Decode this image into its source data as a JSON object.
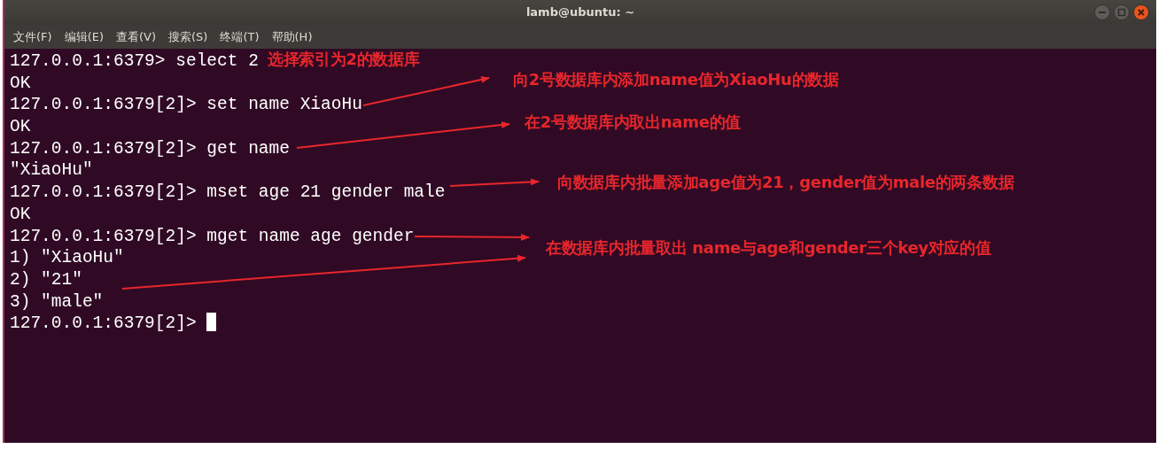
{
  "window": {
    "title": "lamb@ubuntu: ~"
  },
  "menu": [
    "文件(F)",
    "编辑(E)",
    "查看(V)",
    "搜索(S)",
    "终端(T)",
    "帮助(H)"
  ],
  "terminal": {
    "lines": [
      "127.0.0.1:6379> select 2",
      "OK",
      "127.0.0.1:6379[2]> set name XiaoHu",
      "OK",
      "127.0.0.1:6379[2]> get name",
      "\"XiaoHu\"",
      "127.0.0.1:6379[2]> mset age 21 gender male",
      "OK",
      "127.0.0.1:6379[2]> mget name age gender",
      "1) \"XiaoHu\"",
      "2) \"21\"",
      "3) \"male\"",
      "127.0.0.1:6379[2]> "
    ],
    "cursor": true
  },
  "annotations": [
    "选择索引为2的数据库",
    "向2号数据库内添加name值为XiaoHu的数据",
    "在2号数据库内取出name的值",
    "向数据库内批量添加age值为21，gender值为male的两条数据",
    "在数据库内批量取出 name与age和gender三个key对应的值"
  ]
}
